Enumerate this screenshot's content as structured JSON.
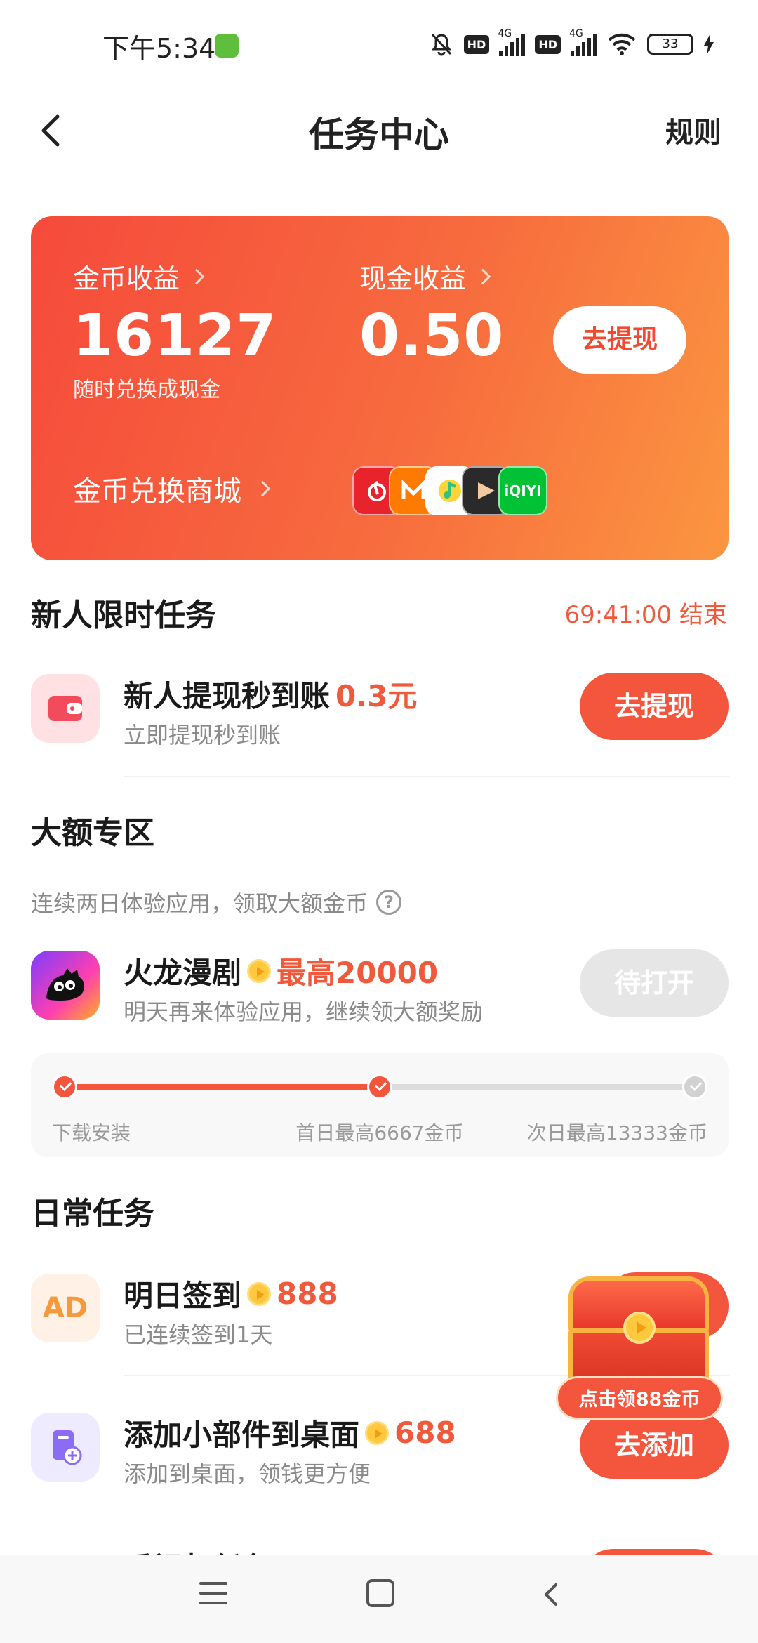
{
  "status_bar": {
    "time": "下午5:34",
    "network_1": "4G",
    "network_2": "4G",
    "hd_1": "HD",
    "hd_2": "HD",
    "battery": "33"
  },
  "nav": {
    "title": "任务中心",
    "rules": "规则"
  },
  "earnings": {
    "coin_label": "金币收益",
    "coin_value": "16127",
    "coin_sub": "随时兑换成现金",
    "cash_label": "现金收益",
    "cash_value": "0.50",
    "withdraw_button": "去提现",
    "mall_label": "金币兑换商城",
    "mall_icons": [
      "netease-music-icon",
      "mango-tv-icon",
      "qq-music-icon",
      "kuaikan-icon",
      "iqiyi-icon"
    ],
    "mall_icon_iqiyi_text": "iQIYI"
  },
  "newbie": {
    "title": "新人限时任务",
    "countdown": "69:41:00 结束",
    "task": {
      "title": "新人提现秒到账",
      "reward": "0.3元",
      "subtitle": "立即提现秒到账",
      "button": "去提现"
    }
  },
  "big": {
    "title": "大额专区",
    "note": "连续两日体验应用，领取大额金币",
    "help": "?",
    "task": {
      "title": "火龙漫剧",
      "reward": "最高20000",
      "subtitle": "明天再来体验应用，继续领大额奖励",
      "button": "待打开"
    },
    "progress": {
      "steps": [
        "下载安装",
        "首日最高6667金币",
        "次日最高13333金币"
      ],
      "completed": 2,
      "total": 3
    }
  },
  "daily": {
    "title": "日常任务",
    "tasks": [
      {
        "title": "明日签到",
        "reward": "888",
        "subtitle": "已连续签到1天",
        "icon_text": "AD"
      },
      {
        "title": "添加小部件到桌面",
        "reward": "688",
        "subtitle": "添加到桌面，领钱更方便",
        "button": "去添加"
      }
    ],
    "partial_title": "看视频任务"
  },
  "chest": {
    "label": "点击领88金币"
  },
  "colors": {
    "accent": "#f4553d",
    "card_start": "#f54a3b",
    "card_end": "#fb9640",
    "reward_text": "#f05a3c"
  }
}
